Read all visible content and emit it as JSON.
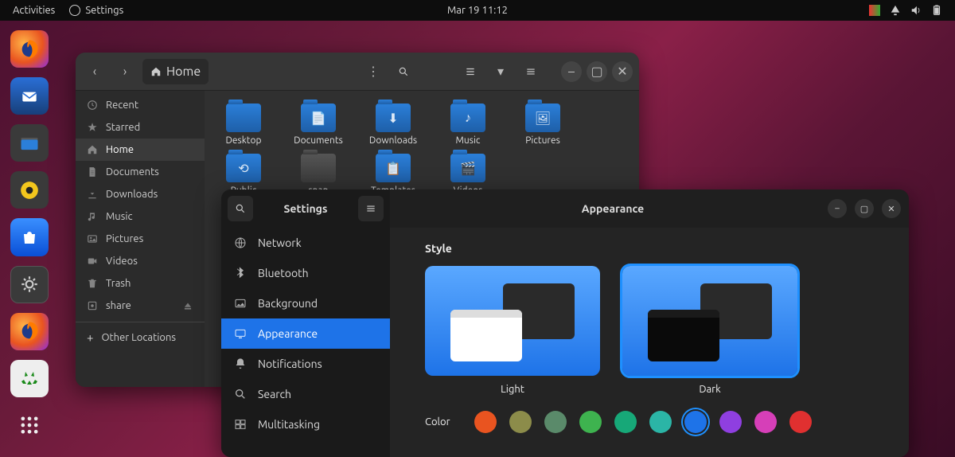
{
  "topbar": {
    "activities": "Activities",
    "app": "Settings",
    "datetime": "Mar 19  11:12"
  },
  "files": {
    "path_label": "Home",
    "sidebar": [
      {
        "icon": "clock",
        "label": "Recent"
      },
      {
        "icon": "star",
        "label": "Starred"
      },
      {
        "icon": "home",
        "label": "Home",
        "active": true
      },
      {
        "icon": "doc",
        "label": "Documents"
      },
      {
        "icon": "download",
        "label": "Downloads"
      },
      {
        "icon": "music",
        "label": "Music"
      },
      {
        "icon": "picture",
        "label": "Pictures"
      },
      {
        "icon": "video",
        "label": "Videos"
      },
      {
        "icon": "trash",
        "label": "Trash"
      },
      {
        "icon": "disk",
        "label": "share",
        "eject": true
      }
    ],
    "other_locations": "Other Locations",
    "folders": [
      {
        "label": "Desktop",
        "glyph": "",
        "grey": false
      },
      {
        "label": "Documents",
        "glyph": "📄"
      },
      {
        "label": "Downloads",
        "glyph": "⬇"
      },
      {
        "label": "Music",
        "glyph": "♪"
      },
      {
        "label": "Pictures",
        "glyph": "🖼"
      },
      {
        "label": "Public",
        "glyph": "⟲"
      },
      {
        "label": "snap",
        "glyph": "",
        "grey": true
      },
      {
        "label": "Templates",
        "glyph": "📋"
      },
      {
        "label": "Videos",
        "glyph": "🎬"
      }
    ]
  },
  "settings": {
    "sidebar_title": "Settings",
    "page_title": "Appearance",
    "items": [
      {
        "icon": "globe",
        "label": "Network"
      },
      {
        "icon": "bt",
        "label": "Bluetooth"
      },
      {
        "icon": "bg",
        "label": "Background"
      },
      {
        "icon": "appear",
        "label": "Appearance",
        "active": true
      },
      {
        "icon": "bell",
        "label": "Notifications"
      },
      {
        "icon": "search",
        "label": "Search"
      },
      {
        "icon": "multi",
        "label": "Multitasking"
      }
    ],
    "section_style": "Style",
    "styles": [
      {
        "name": "Light",
        "selected": false
      },
      {
        "name": "Dark",
        "selected": true
      }
    ],
    "color_label": "Color",
    "colors": [
      {
        "hex": "#e95420"
      },
      {
        "hex": "#8c8c4a"
      },
      {
        "hex": "#5a8a6a"
      },
      {
        "hex": "#3eb34f"
      },
      {
        "hex": "#17a878"
      },
      {
        "hex": "#2bb5a6"
      },
      {
        "hex": "#1e73e8",
        "selected": true
      },
      {
        "hex": "#8f3fe0"
      },
      {
        "hex": "#d63fb8"
      },
      {
        "hex": "#e03030"
      }
    ]
  }
}
